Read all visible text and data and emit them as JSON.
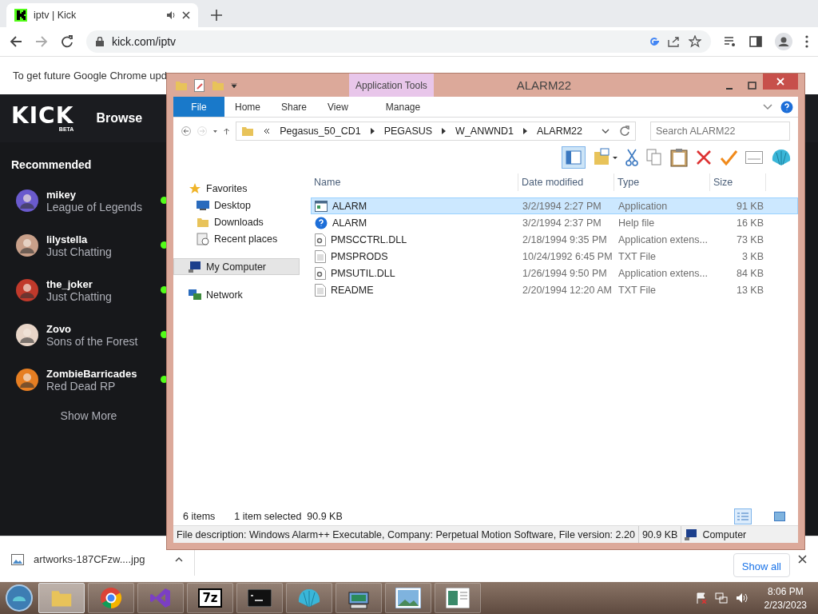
{
  "browser": {
    "tab": {
      "title": "iptv | Kick",
      "audible": true
    },
    "address": "kick.com/iptv",
    "infobar": "To get future Google Chrome upd"
  },
  "kick": {
    "logo": "KICK",
    "logo_badge": "BETA",
    "nav": "Browse",
    "section": "Recommended",
    "show_more": "Show More",
    "channels": [
      {
        "name": "mikey",
        "category": "League of Legends",
        "live": true,
        "color": "#6a5acd"
      },
      {
        "name": "lilystella",
        "category": "Just Chatting",
        "live": true,
        "color": "#c9a08a"
      },
      {
        "name": "the_joker",
        "category": "Just Chatting",
        "live": true,
        "color": "#c0392b"
      },
      {
        "name": "Zovo",
        "category": "Sons of the Forest",
        "live": true,
        "color": "#e8d5c8"
      },
      {
        "name": "ZombieBarricades",
        "category": "Red Dead RP",
        "live": true,
        "color": "#e67e22"
      }
    ]
  },
  "downloads": {
    "file": "artworks-187CFzw....jpg",
    "show_all": "Show all"
  },
  "explorer": {
    "title": "ALARM22",
    "context_tab": "Application Tools",
    "ribbon_tabs": [
      {
        "label": "File",
        "kind": "file"
      },
      {
        "label": "Home",
        "kind": "normal"
      },
      {
        "label": "Share",
        "kind": "normal"
      },
      {
        "label": "View",
        "kind": "normal"
      },
      {
        "label": "Manage",
        "kind": "context"
      }
    ],
    "breadcrumb": [
      "Pegasus_50_CD1",
      "PEGASUS",
      "W_ANWND1",
      "ALARM22"
    ],
    "search": {
      "placeholder": "Search ALARM22"
    },
    "nav": [
      {
        "label": "Favorites",
        "kind": "favorites",
        "selected": false,
        "children": [
          {
            "label": "Desktop",
            "kind": "desktop",
            "selected": false
          },
          {
            "label": "Downloads",
            "kind": "downloads",
            "selected": false
          },
          {
            "label": "Recent places",
            "kind": "recent",
            "selected": false
          }
        ]
      },
      {
        "label": "My Computer",
        "kind": "computer",
        "selected": true
      },
      {
        "label": "Network",
        "kind": "network",
        "selected": false
      }
    ],
    "columns": [
      "Name",
      "Date modified",
      "Type",
      "Size"
    ],
    "rows": [
      {
        "name": "ALARM",
        "date": "3/2/1994 2:27 PM",
        "type": "Application",
        "size": "91 KB",
        "kind": "application",
        "selected": true
      },
      {
        "name": "ALARM",
        "date": "3/2/1994 2:37 PM",
        "type": "Help file",
        "size": "16 KB",
        "kind": "help",
        "selected": false
      },
      {
        "name": "PMSCCTRL.DLL",
        "date": "2/18/1994 9:35 PM",
        "type": "Application extens...",
        "size": "73 KB",
        "kind": "dll",
        "selected": false
      },
      {
        "name": "PMSPRODS",
        "date": "10/24/1992 6:45 PM",
        "type": "TXT File",
        "size": "3 KB",
        "kind": "text",
        "selected": false
      },
      {
        "name": "PMSUTIL.DLL",
        "date": "1/26/1994 9:50 PM",
        "type": "Application extens...",
        "size": "84 KB",
        "kind": "dll",
        "selected": false
      },
      {
        "name": "README",
        "date": "2/20/1994 12:20 AM",
        "type": "TXT File",
        "size": "13 KB",
        "kind": "text",
        "selected": false
      }
    ],
    "status": {
      "count": "6 items",
      "selection": "1 item selected  90.9 KB"
    },
    "details": {
      "description": "File description: Windows Alarm++ Executable, Company: Perpetual Motion Software, File version: 2.20",
      "size": "90.9 KB",
      "zone": "Computer"
    }
  },
  "taskbar": {
    "apps": [
      {
        "kind": "explorer",
        "selected": true
      },
      {
        "kind": "chrome",
        "selected": false
      },
      {
        "kind": "studio",
        "selected": false
      },
      {
        "kind": "sevenzip",
        "label": "7z",
        "selected": false
      },
      {
        "kind": "console",
        "selected": false
      },
      {
        "kind": "shell",
        "selected": false
      },
      {
        "kind": "vcd",
        "selected": false
      },
      {
        "kind": "photo",
        "selected": false
      },
      {
        "kind": "document",
        "selected": false
      }
    ],
    "time": "8:06 PM",
    "date": "2/23/2023"
  }
}
